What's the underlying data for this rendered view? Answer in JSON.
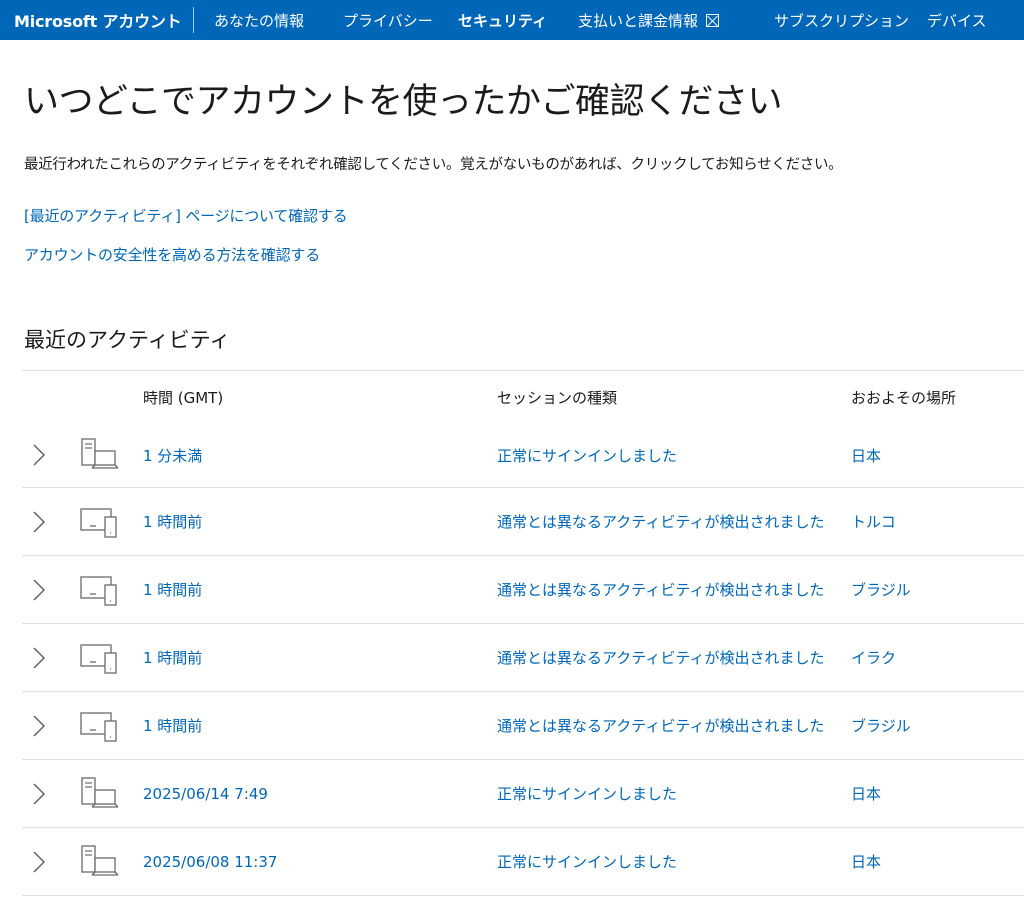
{
  "nav": {
    "brand": "Microsoft アカウント",
    "items": [
      {
        "label": "あなたの情報",
        "active": false
      },
      {
        "label": "プライバシー",
        "active": false
      },
      {
        "label": "セキュリティ",
        "active": true
      },
      {
        "label": "支払いと課金情報",
        "active": false,
        "icon": "external-link-icon"
      },
      {
        "label": "サブスクリプション",
        "active": false
      },
      {
        "label": "デバイス",
        "active": false
      }
    ]
  },
  "page": {
    "title": "いつどこでアカウントを使ったかご確認ください",
    "intro": "最近行われたこれらのアクティビティをそれぞれ確認してください。覚えがないものがあれば、クリックしてお知らせください。",
    "links": [
      "[最近のアクティビティ] ページについて確認する",
      "アカウントの安全性を高める方法を確認する"
    ]
  },
  "activity": {
    "section_title": "最近のアクティビティ",
    "columns": {
      "time": "時間 (GMT)",
      "session": "セッションの種類",
      "location": "おおよその場所"
    },
    "rows": [
      {
        "device_icon": "desktop-computer-icon",
        "time": "1 分未満",
        "session": "正常にサインインしました",
        "location": "日本"
      },
      {
        "device_icon": "multi-device-icon",
        "time": "1 時間前",
        "session": "通常とは異なるアクティビティが検出されました",
        "location": "トルコ"
      },
      {
        "device_icon": "multi-device-icon",
        "time": "1 時間前",
        "session": "通常とは異なるアクティビティが検出されました",
        "location": "ブラジル"
      },
      {
        "device_icon": "multi-device-icon",
        "time": "1 時間前",
        "session": "通常とは異なるアクティビティが検出されました",
        "location": "イラク"
      },
      {
        "device_icon": "multi-device-icon",
        "time": "1 時間前",
        "session": "通常とは異なるアクティビティが検出されました",
        "location": "ブラジル"
      },
      {
        "device_icon": "desktop-computer-icon",
        "time": "2025/06/14 7:49",
        "session": "正常にサインインしました",
        "location": "日本"
      },
      {
        "device_icon": "desktop-computer-icon",
        "time": "2025/06/08 11:37",
        "session": "正常にサインインしました",
        "location": "日本"
      }
    ]
  },
  "colors": {
    "header_bg": "#0067b8",
    "link": "#0067b8",
    "text": "#1b1b1b",
    "divider": "#e1e1e1"
  }
}
